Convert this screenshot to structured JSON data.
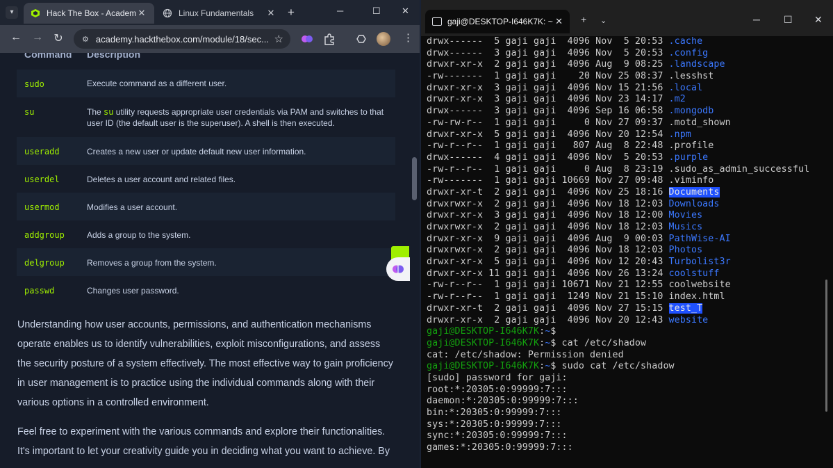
{
  "browser": {
    "tabs": [
      {
        "title": "Hack The Box - Academy",
        "active": true
      },
      {
        "title": "Linux Fundamentals",
        "active": false
      }
    ],
    "url": "academy.hackthebox.com/module/18/sec...",
    "accent": "#9fef00"
  },
  "table": {
    "headers": [
      "Command",
      "Description"
    ],
    "rows": [
      {
        "cmd": "sudo",
        "desc": "Execute command as a different user."
      },
      {
        "cmd": "su",
        "desc_pre": "The ",
        "desc_code": "su",
        "desc_post": " utility requests appropriate user credentials via PAM and switches to that user ID (the default user is the superuser). A shell is then executed."
      },
      {
        "cmd": "useradd",
        "desc": "Creates a new user or update default new user information."
      },
      {
        "cmd": "userdel",
        "desc": "Deletes a user account and related files."
      },
      {
        "cmd": "usermod",
        "desc": "Modifies a user account."
      },
      {
        "cmd": "addgroup",
        "desc": "Adds a group to the system."
      },
      {
        "cmd": "delgroup",
        "desc": "Removes a group from the system."
      },
      {
        "cmd": "passwd",
        "desc": "Changes user password."
      }
    ]
  },
  "paragraphs": [
    "Understanding how user accounts, permissions, and authentication mechanisms operate enables us to identify vulnerabilities, exploit misconfigurations, and assess the security posture of a system effectively. The most effective way to gain proficiency in user management is to practice using the individual commands along with their various options in a controlled environment.",
    "Feel free to experiment with the various commands and explore their functionalities. It's important to let your creativity guide you in deciding what you want to achieve. By"
  ],
  "terminal": {
    "title": "gaji@DESKTOP-I646K7K: ~",
    "lines": [
      {
        "t": "drwx------  5 gaji gaji  4096 Nov  5 20:53 ",
        "n": ".cache",
        "k": "d"
      },
      {
        "t": "drwx------  3 gaji gaji  4096 Nov  5 20:53 ",
        "n": ".config",
        "k": "d"
      },
      {
        "t": "drwxr-xr-x  2 gaji gaji  4096 Aug  9 08:25 ",
        "n": ".landscape",
        "k": "d"
      },
      {
        "t": "-rw-------  1 gaji gaji    20 Nov 25 08:37 ",
        "n": ".lesshst",
        "k": "f"
      },
      {
        "t": "drwxr-xr-x  3 gaji gaji  4096 Nov 15 21:56 ",
        "n": ".local",
        "k": "d"
      },
      {
        "t": "drwxr-xr-x  3 gaji gaji  4096 Nov 23 14:17 ",
        "n": ".m2",
        "k": "d"
      },
      {
        "t": "drwx------  3 gaji gaji  4096 Sep 16 06:58 ",
        "n": ".mongodb",
        "k": "d"
      },
      {
        "t": "-rw-rw-r--  1 gaji gaji     0 Nov 27 09:37 ",
        "n": ".motd_shown",
        "k": "f"
      },
      {
        "t": "drwxr-xr-x  5 gaji gaji  4096 Nov 20 12:54 ",
        "n": ".npm",
        "k": "d"
      },
      {
        "t": "-rw-r--r--  1 gaji gaji   807 Aug  8 22:48 ",
        "n": ".profile",
        "k": "f"
      },
      {
        "t": "drwx------  4 gaji gaji  4096 Nov  5 20:53 ",
        "n": ".purple",
        "k": "d"
      },
      {
        "t": "-rw-r--r--  1 gaji gaji     0 Aug  8 23:19 ",
        "n": ".sudo_as_admin_successful",
        "k": "f"
      },
      {
        "t": "-rw-------  1 gaji gaji 10669 Nov 27 09:48 ",
        "n": ".viminfo",
        "k": "f"
      },
      {
        "t": "drwxr-xr-t  2 gaji gaji  4096 Nov 25 18:16 ",
        "n": "Documents",
        "k": "h"
      },
      {
        "t": "drwxrwxr-x  2 gaji gaji  4096 Nov 18 12:03 ",
        "n": "Downloads",
        "k": "d"
      },
      {
        "t": "drwxr-xr-x  3 gaji gaji  4096 Nov 18 12:00 ",
        "n": "Movies",
        "k": "d"
      },
      {
        "t": "drwxrwxr-x  2 gaji gaji  4096 Nov 18 12:03 ",
        "n": "Musics",
        "k": "d"
      },
      {
        "t": "drwxr-xr-x  9 gaji gaji  4096 Aug  9 00:03 ",
        "n": "PathWise-AI",
        "k": "d"
      },
      {
        "t": "drwxrwxr-x  2 gaji gaji  4096 Nov 18 12:03 ",
        "n": "Photos",
        "k": "d"
      },
      {
        "t": "drwxr-xr-x  5 gaji gaji  4096 Nov 12 20:43 ",
        "n": "Turbolist3r",
        "k": "d"
      },
      {
        "t": "drwxr-xr-x 11 gaji gaji  4096 Nov 26 13:24 ",
        "n": "coolstuff",
        "k": "d"
      },
      {
        "t": "-rw-r--r--  1 gaji gaji 10671 Nov 21 12:55 ",
        "n": "coolwebsite",
        "k": "f"
      },
      {
        "t": "-rw-r--r--  1 gaji gaji  1249 Nov 21 15:10 ",
        "n": "index.html",
        "k": "f"
      },
      {
        "t": "drwxr-xr-t  2 gaji gaji  4096 Nov 27 15:15 ",
        "n": "test_T",
        "k": "h"
      },
      {
        "t": "drwxr-xr-x  2 gaji gaji  4096 Nov 20 12:43 ",
        "n": "website",
        "k": "d"
      },
      {
        "prompt": "gaji@DESKTOP-I646K7K",
        "path": "~",
        "cmd": ""
      },
      {
        "prompt": "gaji@DESKTOP-I646K7K",
        "path": "~",
        "cmd": " cat /etc/shadow"
      },
      {
        "t": "cat: /etc/shadow: Permission denied",
        "k": "o"
      },
      {
        "prompt": "gaji@DESKTOP-I646K7K",
        "path": "~",
        "cmd": " sudo cat /etc/shadow"
      },
      {
        "t": "[sudo] password for gaji:",
        "k": "o"
      },
      {
        "t": "root:*:20305:0:99999:7:::",
        "k": "o"
      },
      {
        "t": "daemon:*:20305:0:99999:7:::",
        "k": "o"
      },
      {
        "t": "bin:*:20305:0:99999:7:::",
        "k": "o"
      },
      {
        "t": "sys:*:20305:0:99999:7:::",
        "k": "o"
      },
      {
        "t": "sync:*:20305:0:99999:7:::",
        "k": "o"
      },
      {
        "t": "games:*:20305:0:99999:7:::",
        "k": "o"
      }
    ],
    "colors": {
      "dir": "#3b78ff",
      "prompt": "#13a10e",
      "highlight_bg": "#1f51ff",
      "text": "#cccccc"
    }
  }
}
